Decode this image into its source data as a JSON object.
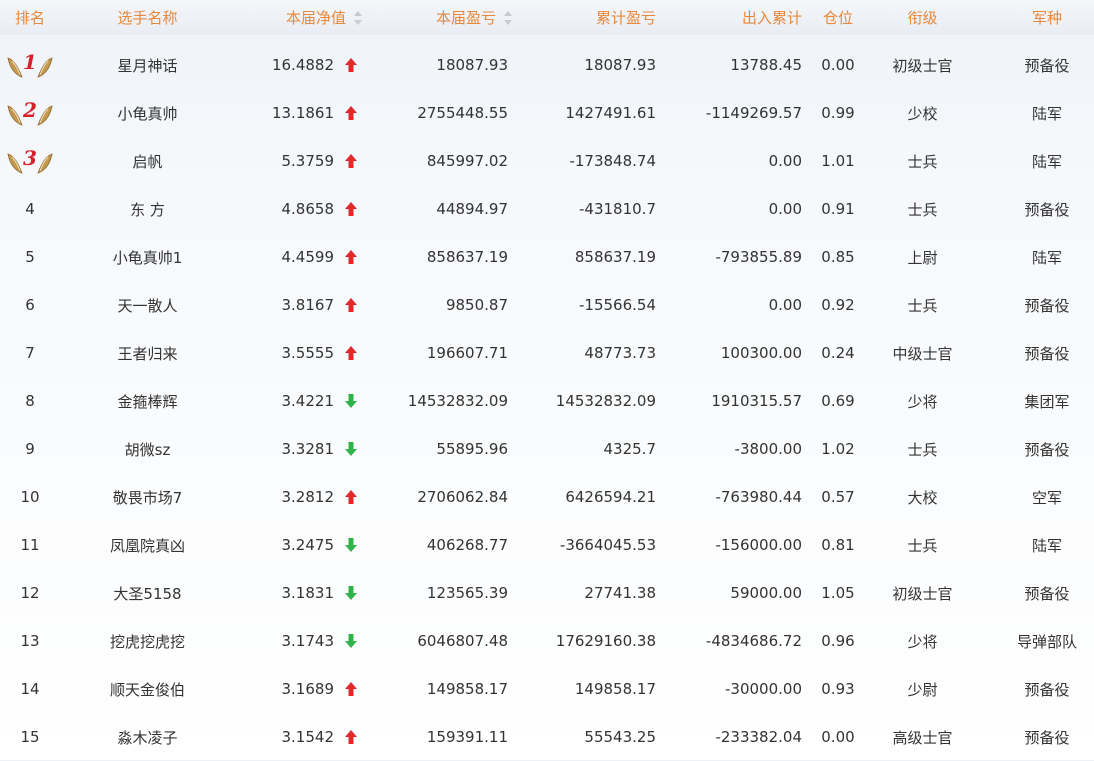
{
  "colors": {
    "header_text": "#e8883a",
    "up": "#e02a2a",
    "down": "#2fb44a",
    "medal_num": "#d8202a",
    "wing": "#c59a4e"
  },
  "header": {
    "rank": "排名",
    "name": "选手名称",
    "nav": "本届净值",
    "pnl": "本届盈亏",
    "cum": "累计盈亏",
    "io": "出入累计",
    "pos": "仓位",
    "title": "衔级",
    "arm": "军种"
  },
  "rows": [
    {
      "rank": "1",
      "name": "星月神话",
      "nav": "16.4882",
      "trend": "up",
      "pnl": "18087.93",
      "cum": "18087.93",
      "io": "13788.45",
      "pos": "0.00",
      "title": "初级士官",
      "arm": "预备役"
    },
    {
      "rank": "2",
      "name": "小龟真帅",
      "nav": "13.1861",
      "trend": "up",
      "pnl": "2755448.55",
      "cum": "1427491.61",
      "io": "-1149269.57",
      "pos": "0.99",
      "title": "少校",
      "arm": "陆军"
    },
    {
      "rank": "3",
      "name": "启帆",
      "nav": "5.3759",
      "trend": "up",
      "pnl": "845997.02",
      "cum": "-173848.74",
      "io": "0.00",
      "pos": "1.01",
      "title": "士兵",
      "arm": "陆军"
    },
    {
      "rank": "4",
      "name": "东 方",
      "nav": "4.8658",
      "trend": "up",
      "pnl": "44894.97",
      "cum": "-431810.7",
      "io": "0.00",
      "pos": "0.91",
      "title": "士兵",
      "arm": "预备役"
    },
    {
      "rank": "5",
      "name": "小龟真帅1",
      "nav": "4.4599",
      "trend": "up",
      "pnl": "858637.19",
      "cum": "858637.19",
      "io": "-793855.89",
      "pos": "0.85",
      "title": "上尉",
      "arm": "陆军"
    },
    {
      "rank": "6",
      "name": "天一散人",
      "nav": "3.8167",
      "trend": "up",
      "pnl": "9850.87",
      "cum": "-15566.54",
      "io": "0.00",
      "pos": "0.92",
      "title": "士兵",
      "arm": "预备役"
    },
    {
      "rank": "7",
      "name": "王者归来",
      "nav": "3.5555",
      "trend": "up",
      "pnl": "196607.71",
      "cum": "48773.73",
      "io": "100300.00",
      "pos": "0.24",
      "title": "中级士官",
      "arm": "预备役"
    },
    {
      "rank": "8",
      "name": "金箍棒辉",
      "nav": "3.4221",
      "trend": "down",
      "pnl": "14532832.09",
      "cum": "14532832.09",
      "io": "1910315.57",
      "pos": "0.69",
      "title": "少将",
      "arm": "集团军"
    },
    {
      "rank": "9",
      "name": "胡微sz",
      "nav": "3.3281",
      "trend": "down",
      "pnl": "55895.96",
      "cum": "4325.7",
      "io": "-3800.00",
      "pos": "1.02",
      "title": "士兵",
      "arm": "预备役"
    },
    {
      "rank": "10",
      "name": "敬畏市场7",
      "nav": "3.2812",
      "trend": "up",
      "pnl": "2706062.84",
      "cum": "6426594.21",
      "io": "-763980.44",
      "pos": "0.57",
      "title": "大校",
      "arm": "空军"
    },
    {
      "rank": "11",
      "name": "凤凰院真凶",
      "nav": "3.2475",
      "trend": "down",
      "pnl": "406268.77",
      "cum": "-3664045.53",
      "io": "-156000.00",
      "pos": "0.81",
      "title": "士兵",
      "arm": "陆军"
    },
    {
      "rank": "12",
      "name": "大圣5158",
      "nav": "3.1831",
      "trend": "down",
      "pnl": "123565.39",
      "cum": "27741.38",
      "io": "59000.00",
      "pos": "1.05",
      "title": "初级士官",
      "arm": "预备役"
    },
    {
      "rank": "13",
      "name": "挖虎挖虎挖",
      "nav": "3.1743",
      "trend": "down",
      "pnl": "6046807.48",
      "cum": "17629160.38",
      "io": "-4834686.72",
      "pos": "0.96",
      "title": "少将",
      "arm": "导弹部队"
    },
    {
      "rank": "14",
      "name": "顺天金俊伯",
      "nav": "3.1689",
      "trend": "up",
      "pnl": "149858.17",
      "cum": "149858.17",
      "io": "-30000.00",
      "pos": "0.93",
      "title": "少尉",
      "arm": "预备役"
    },
    {
      "rank": "15",
      "name": "淼木凌子",
      "nav": "3.1542",
      "trend": "up",
      "pnl": "159391.11",
      "cum": "55543.25",
      "io": "-233382.04",
      "pos": "0.00",
      "title": "高级士官",
      "arm": "预备役"
    }
  ]
}
